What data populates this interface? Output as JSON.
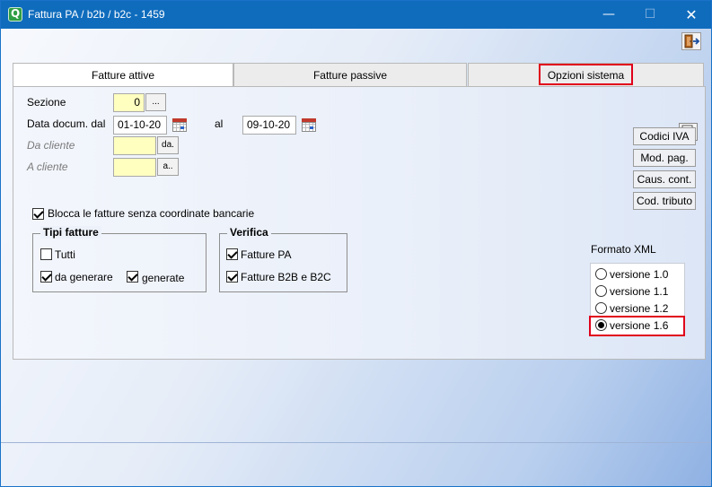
{
  "window": {
    "title": "Fattura PA / b2b / b2c - 1459",
    "min_symbol": "—",
    "max_symbol": "☐",
    "close_symbol": "✕",
    "icons": {
      "app": "app-logo-icon",
      "exit": "exit-door-icon",
      "preview": "preview-icon",
      "calendar": "calendar-icon"
    }
  },
  "tabs": [
    {
      "label": "Fatture attive",
      "active": true
    },
    {
      "label": "Fatture passive",
      "active": false
    },
    {
      "label": "Opzioni sistema",
      "active": false
    }
  ],
  "filters": {
    "sezione_label": "Sezione",
    "sezione_value": "0",
    "sezione_button": "...",
    "data_dal_label": "Data docum. dal",
    "data_dal_value": "01-10-20",
    "al_label": "al",
    "data_al_value": "09-10-20",
    "da_cliente_label": "Da cliente",
    "da_cliente_value": "",
    "da_cliente_button": "da.",
    "a_cliente_label": "A cliente",
    "a_cliente_value": "",
    "a_cliente_button": "a.."
  },
  "side_buttons": [
    "Codici IVA",
    "Mod. pag.",
    "Caus. cont.",
    "Cod. tributo"
  ],
  "blocca": {
    "label": "Blocca le fatture senza coordinate bancarie",
    "checked": true
  },
  "tipi_fatture": {
    "title": "Tipi fatture",
    "tutti": {
      "label": "Tutti",
      "checked": false
    },
    "da_generare": {
      "label": "da generare",
      "checked": true
    },
    "generate": {
      "label": "generate",
      "checked": true
    }
  },
  "verifica": {
    "title": "Verifica",
    "pa": {
      "label": "Fatture PA",
      "checked": true
    },
    "b2b": {
      "label": "Fatture B2B e B2C",
      "checked": true
    }
  },
  "formato_xml": {
    "title": "Formato XML",
    "options": [
      "versione 1.0",
      "versione 1.1",
      "versione 1.2",
      "versione 1.6"
    ],
    "selected": "versione 1.6"
  },
  "highlight_color": "#e0001b"
}
